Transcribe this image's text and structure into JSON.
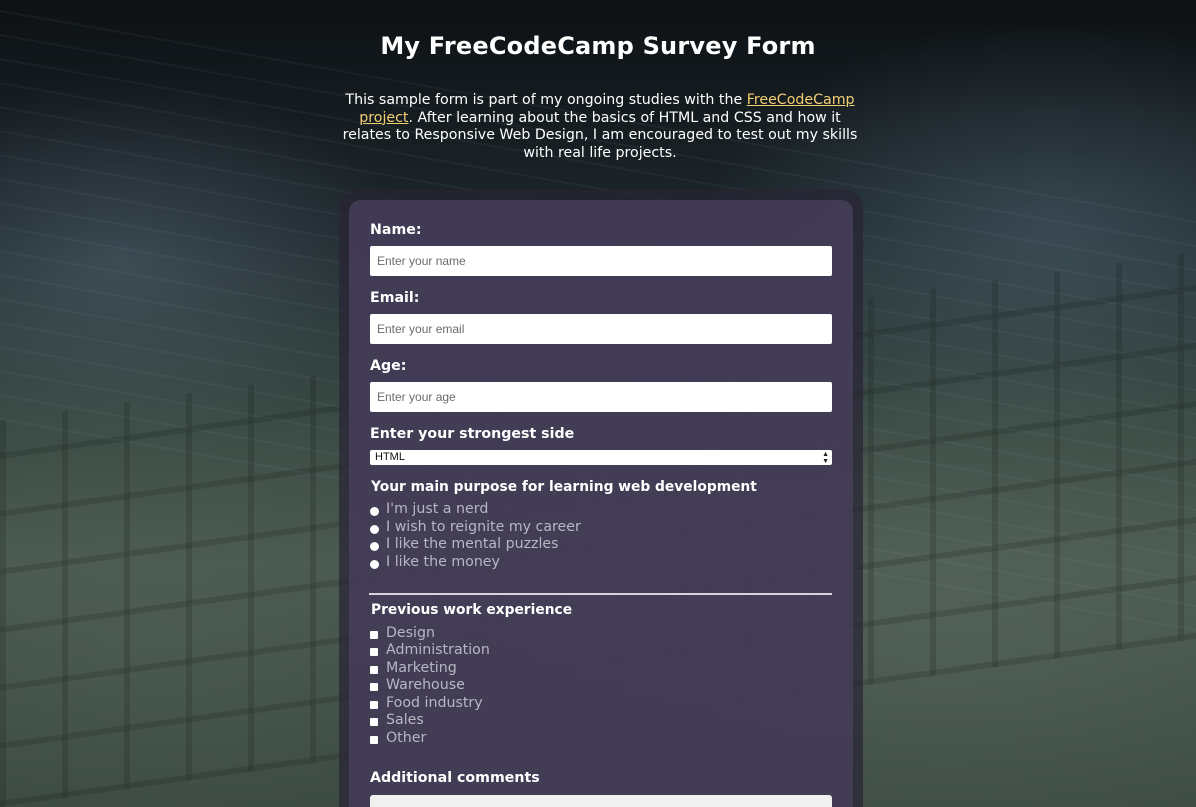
{
  "page": {
    "title": "My FreeCodeCamp Survey Form",
    "intro_before": "This sample form is part of my ongoing studies with the ",
    "intro_link": "FreeCodeCamp project",
    "intro_after": ". After learning about the basics of HTML and CSS and how it relates to Responsive Web Design, I am encouraged to test out my skills with real life projects."
  },
  "form": {
    "name": {
      "label": "Name:",
      "placeholder": "Enter your name",
      "value": ""
    },
    "email": {
      "label": "Email:",
      "placeholder": "Enter your email",
      "value": ""
    },
    "age": {
      "label": "Age:",
      "placeholder": "Enter your age",
      "value": ""
    },
    "strongest_side": {
      "label": "Enter your strongest side",
      "selected": "HTML"
    },
    "purpose": {
      "title": "Your main purpose for learning web development",
      "options": [
        "I'm just a nerd",
        "I wish to reignite my career",
        "I like the mental puzzles",
        "I like the money"
      ]
    },
    "experience": {
      "title": "Previous work experience",
      "options": [
        "Design",
        "Administration",
        "Marketing",
        "Warehouse",
        "Food industry",
        "Sales",
        "Other"
      ]
    },
    "comments": {
      "label": "Additional comments"
    }
  },
  "colors": {
    "link": "#f3cf74",
    "card": "#48405c",
    "option_text": "#b9b6c4"
  }
}
